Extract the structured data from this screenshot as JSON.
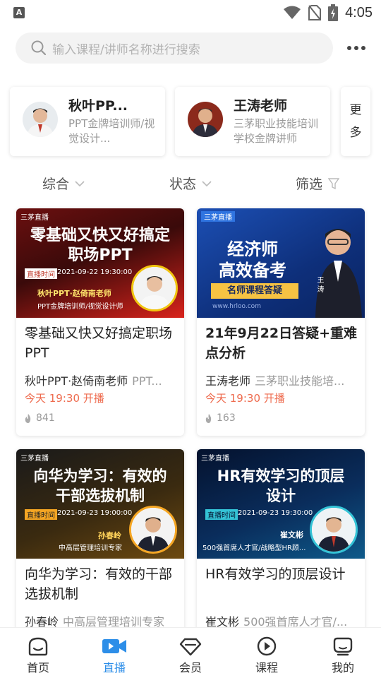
{
  "status_bar": {
    "app_badge": "A",
    "time": "4:05",
    "icons": [
      "wifi-icon",
      "no-sim-icon",
      "battery-charging-icon"
    ]
  },
  "search": {
    "placeholder": "输入课程/讲师名称进行搜索",
    "icon": "search-icon",
    "more_icon": "more-dots-icon"
  },
  "teachers": [
    {
      "name": "秋叶PP...",
      "desc": "PPT金牌培训师/视觉设计..."
    },
    {
      "name": "王涛老师",
      "desc": "三茅职业技能培训学校金牌讲师"
    }
  ],
  "more_label": "更多",
  "filters": [
    {
      "label": "综合",
      "icon": "chevron-down-icon"
    },
    {
      "label": "状态",
      "icon": "chevron-down-icon"
    },
    {
      "label": "筛选",
      "icon": "filter-icon"
    }
  ],
  "courses": [
    {
      "title": "零基础又快又好搞定职场PPT",
      "teacher": "秋叶PPT·赵倚南老师",
      "teacher_sub": "PPT...",
      "live": "今天 19:30 开播",
      "views": "841",
      "thumb": {
        "brand": "三茅直播",
        "headline1": "零基础又快又好搞定",
        "headline2": "职场PPT",
        "time_label": "直播时间",
        "time": "2021-09-22 19:30:00",
        "speaker": "秋叶PPT·赵倚南老师",
        "speaker_title": "PPT金牌培训师/视觉设计师"
      }
    },
    {
      "title": "21年9月22日答疑+重难点分析",
      "teacher": "王涛老师",
      "teacher_sub": "三茅职业技能培...",
      "live": "今天 19:30 开播",
      "views": "163",
      "thumb": {
        "brand": "三茅直播",
        "headline1": "经济师",
        "headline2": "高效备考",
        "ribbon": "名师课程答疑",
        "site": "www.hrloo.com",
        "side_name": "王 涛"
      }
    },
    {
      "title": "向华为学习：有效的干部选拔机制",
      "teacher": "孙春岭",
      "teacher_sub": "中高层管理培训专家",
      "thumb": {
        "brand": "三茅直播",
        "headline1": "向华为学习：有效的",
        "headline2": "干部选拔机制",
        "time_label": "直播时间",
        "time": "2021-09-23 19:00:00",
        "speaker": "孙春岭",
        "speaker_title": "中高层管理培训专家"
      }
    },
    {
      "title": "HR有效学习的顶层设计",
      "teacher": "崔文彬",
      "teacher_sub": "500强首席人才官/...",
      "thumb": {
        "brand": "三茅直播",
        "headline1": "HR有效学习的顶层",
        "headline2": "设计",
        "time_label": "直播时间",
        "time": "2021-09-23 19:30:00",
        "speaker": "崔文彬",
        "speaker_title": "500强首席人才官/战略型HR顾..."
      }
    }
  ],
  "bottom_nav": [
    {
      "label": "首页",
      "icon": "home-icon",
      "active": false
    },
    {
      "label": "直播",
      "icon": "video-camera-icon",
      "active": true
    },
    {
      "label": "会员",
      "icon": "diamond-icon",
      "active": false
    },
    {
      "label": "课程",
      "icon": "play-circle-icon",
      "active": false
    },
    {
      "label": "我的",
      "icon": "profile-icon",
      "active": false
    }
  ],
  "colors": {
    "accent": "#2d8ee8",
    "live_text": "#ee6a4d",
    "muted": "#999999"
  }
}
